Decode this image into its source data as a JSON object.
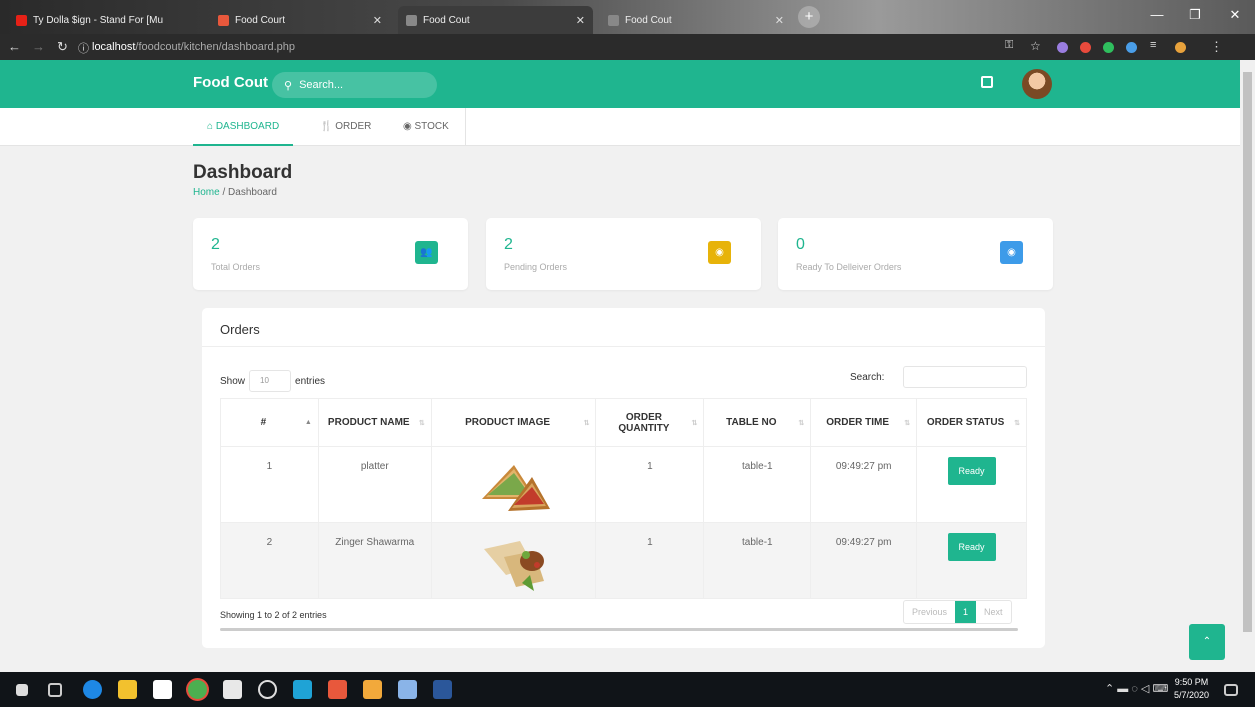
{
  "browser": {
    "tabs": [
      {
        "title": "Ty Dolla $ign - Stand For [Mu",
        "favicon_color": "#e62117"
      },
      {
        "title": "Food Court",
        "favicon_color": "#e8583c"
      },
      {
        "title": "Food Cout",
        "favicon_color": "#888888"
      },
      {
        "title": "Food Cout",
        "favicon_color": "#888888"
      }
    ],
    "url_host": "localhost",
    "url_path": "/foodcout/kitchen/dashboard.php"
  },
  "header": {
    "brand": "Food Cout",
    "search_placeholder": "Search..."
  },
  "nav": [
    {
      "label": "DASHBOARD",
      "icon": "home-icon"
    },
    {
      "label": "ORDER",
      "icon": "utensils-icon"
    },
    {
      "label": "STOCK",
      "icon": "stock-icon"
    }
  ],
  "page": {
    "title": "Dashboard",
    "breadcrumb_home": "Home",
    "breadcrumb_sep": "/",
    "breadcrumb_current": "Dashboard"
  },
  "cards": [
    {
      "value": "2",
      "label": "Total Orders",
      "icon": "users-icon",
      "color": "#1fb58f"
    },
    {
      "value": "2",
      "label": "Pending Orders",
      "icon": "clock-icon",
      "color": "#e7b30a"
    },
    {
      "value": "0",
      "label": "Ready To Delleiver Orders",
      "icon": "check-icon",
      "color": "#3d9be9"
    }
  ],
  "orders": {
    "title": "Orders",
    "show_label": "Show",
    "entries_value": "10",
    "entries_label": "entries",
    "search_label": "Search:",
    "columns": [
      "#",
      "PRODUCT NAME",
      "PRODUCT IMAGE",
      "ORDER QUANTITY",
      "TABLE NO",
      "ORDER TIME",
      "ORDER STATUS"
    ],
    "rows": [
      {
        "num": "1",
        "product": "platter",
        "image": "sandwich",
        "quantity": "1",
        "table": "table-1",
        "time": "09:49:27 pm",
        "status": "Ready"
      },
      {
        "num": "2",
        "product": "Zinger Shawarma",
        "image": "shawarma",
        "quantity": "1",
        "table": "table-1",
        "time": "09:49:27 pm",
        "status": "Ready"
      }
    ],
    "info": "Showing 1 to 2 of 2 entries",
    "pager": {
      "prev": "Previous",
      "page": "1",
      "next": "Next"
    }
  },
  "taskbar": {
    "time": "9:50 PM",
    "date": "5/7/2020"
  }
}
